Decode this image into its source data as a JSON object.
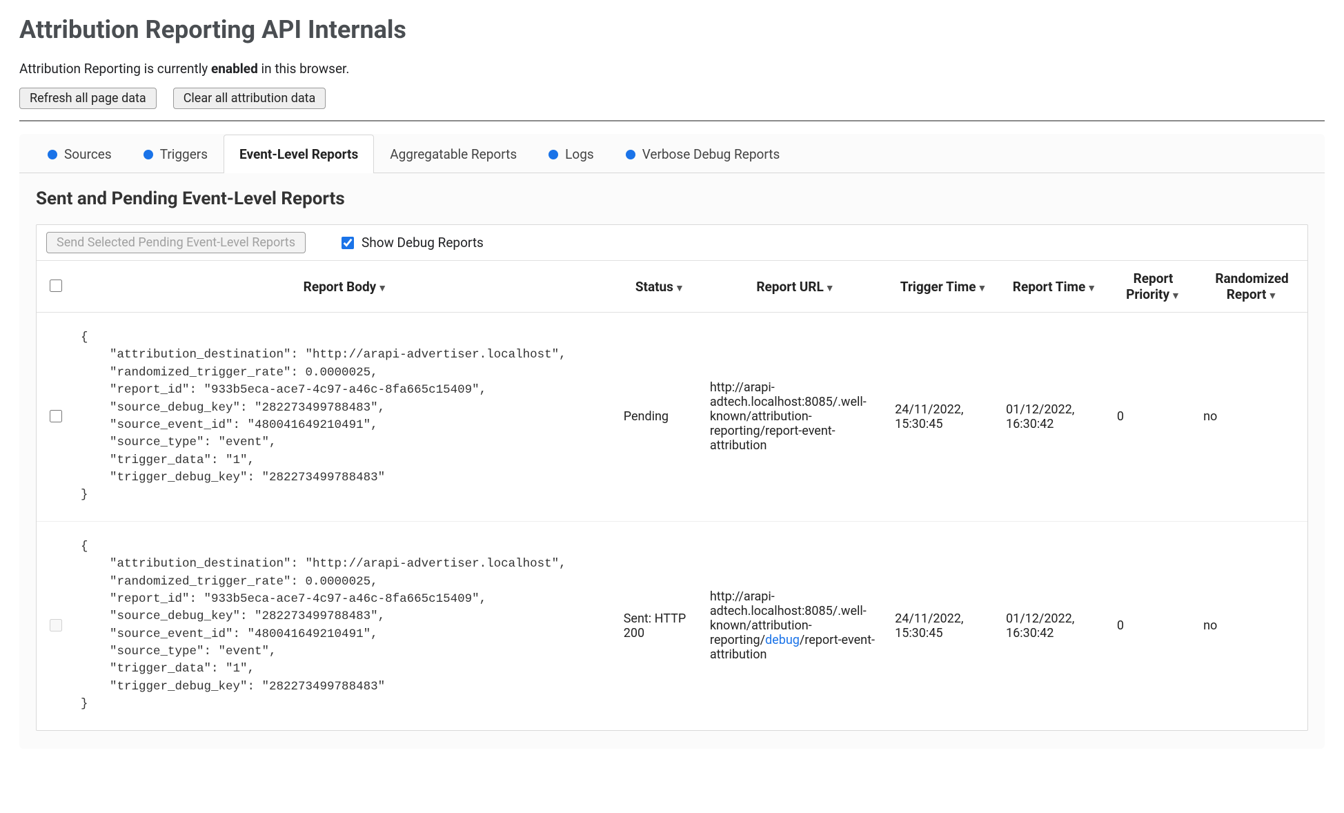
{
  "header": {
    "title": "Attribution Reporting API Internals",
    "status_prefix": "Attribution Reporting is currently ",
    "status_state": "enabled",
    "status_suffix": " in this browser.",
    "refresh_label": "Refresh all page data",
    "clear_label": "Clear all attribution data"
  },
  "tabs": {
    "sources": "Sources",
    "triggers": "Triggers",
    "event_reports": "Event-Level Reports",
    "agg_reports": "Aggregatable Reports",
    "logs": "Logs",
    "verbose": "Verbose Debug Reports"
  },
  "section": {
    "title": "Sent and Pending Event-Level Reports",
    "send_selected_label": "Send Selected Pending Event-Level Reports",
    "show_debug_label": "Show Debug Reports"
  },
  "columns": {
    "body": "Report Body",
    "status": "Status",
    "url": "Report URL",
    "trigger_time": "Trigger Time",
    "report_time": "Report Time",
    "priority": "Report Priority",
    "randomized": "Randomized Report"
  },
  "rows": [
    {
      "body": "{\n    \"attribution_destination\": \"http://arapi-advertiser.localhost\",\n    \"randomized_trigger_rate\": 0.0000025,\n    \"report_id\": \"933b5eca-ace7-4c97-a46c-8fa665c15409\",\n    \"source_debug_key\": \"282273499788483\",\n    \"source_event_id\": \"480041649210491\",\n    \"source_type\": \"event\",\n    \"trigger_data\": \"1\",\n    \"trigger_debug_key\": \"282273499788483\"\n}",
      "status": "Pending",
      "url_pre": "http://arapi-adtech.localhost:8085/.well-known/attribution-reporting/report-event-attribution",
      "url_debug": "",
      "url_post": "",
      "trigger_time": "24/11/2022, 15:30:45",
      "report_time": "01/12/2022, 16:30:42",
      "priority": "0",
      "randomized": "no",
      "cb_enabled": true
    },
    {
      "body": "{\n    \"attribution_destination\": \"http://arapi-advertiser.localhost\",\n    \"randomized_trigger_rate\": 0.0000025,\n    \"report_id\": \"933b5eca-ace7-4c97-a46c-8fa665c15409\",\n    \"source_debug_key\": \"282273499788483\",\n    \"source_event_id\": \"480041649210491\",\n    \"source_type\": \"event\",\n    \"trigger_data\": \"1\",\n    \"trigger_debug_key\": \"282273499788483\"\n}",
      "status": "Sent: HTTP 200",
      "url_pre": "http://arapi-adtech.localhost:8085/.well-known/attribution-reporting/",
      "url_debug": "debug",
      "url_post": "/report-event-attribution",
      "trigger_time": "24/11/2022, 15:30:45",
      "report_time": "01/12/2022, 16:30:42",
      "priority": "0",
      "randomized": "no",
      "cb_enabled": false
    }
  ]
}
